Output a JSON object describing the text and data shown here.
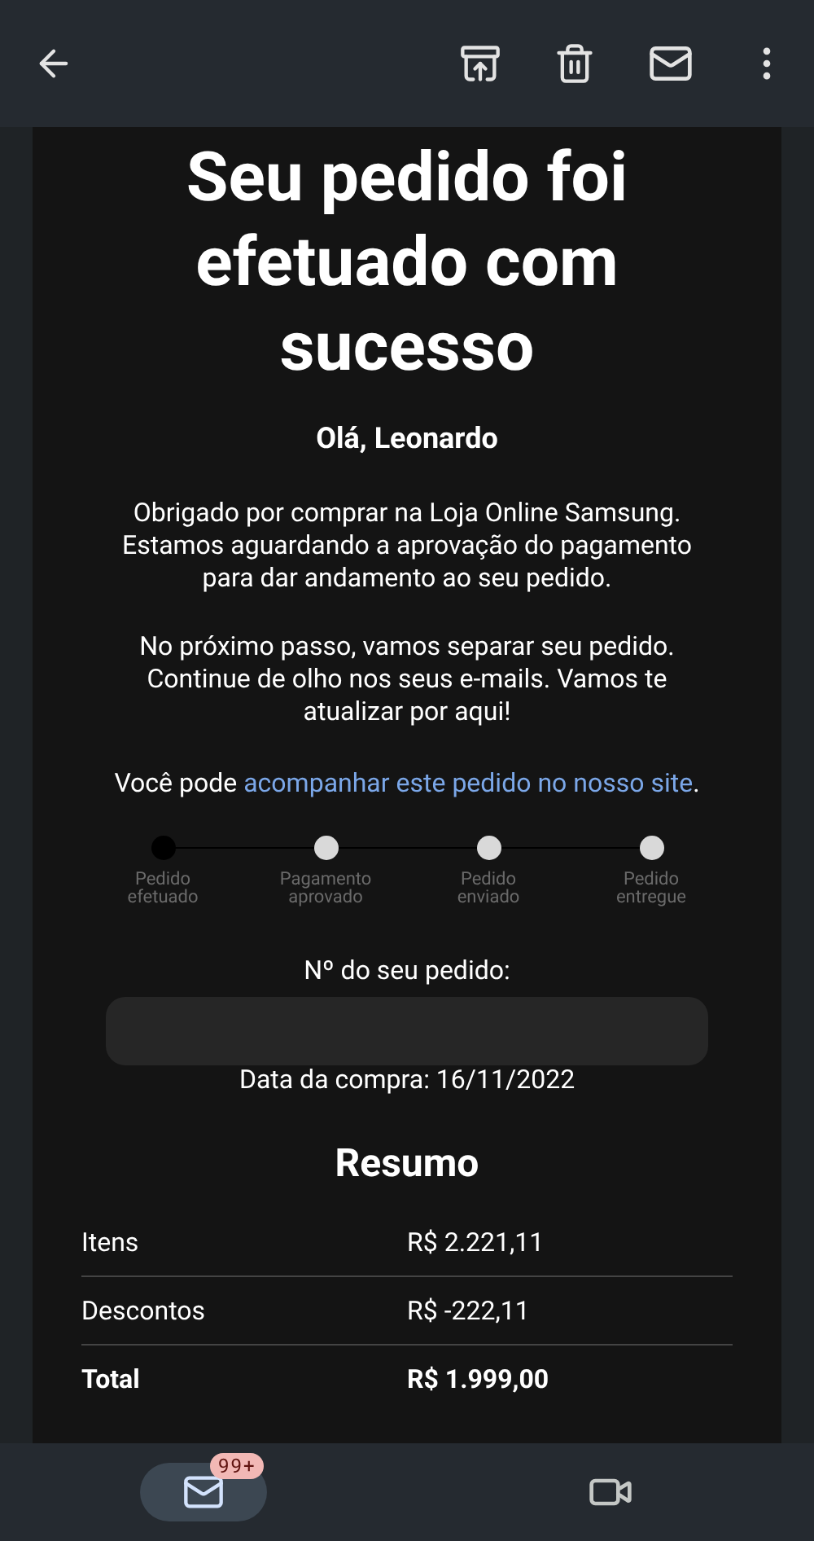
{
  "toolbar": {
    "actions": [
      {
        "kind": "archive"
      },
      {
        "kind": "delete"
      },
      {
        "kind": "mail"
      },
      {
        "kind": "more"
      }
    ]
  },
  "email": {
    "title": "Seu pedido foi efetuado com sucesso",
    "greeting": "Olá, Leonardo",
    "paragraphs": [
      "Obrigado por comprar na Loja Online Samsung. Estamos aguardando a aprovação do pagamento para dar andamento ao seu pedido.",
      "No próximo passo, vamos separar seu pedido. Continue de olho nos seus e-mails. Vamos te atualizar por aqui!"
    ],
    "track": {
      "before": "Você pode ",
      "link": "acompanhar este pedido no nosso site",
      "after": "."
    },
    "steps": [
      {
        "label": "Pedido efetuado",
        "selected": true
      },
      {
        "label": "Pagamento aprovado",
        "selected": false
      },
      {
        "label": "Pedido enviado",
        "selected": false
      },
      {
        "label": "Pedido entregue",
        "selected": false
      }
    ],
    "order_label": "Nº do seu pedido:",
    "purchase_date": "Data da compra: 16/11/2022",
    "summary_title": "Resumo",
    "summary": [
      {
        "label": "Itens",
        "value": "R$ 2.221,11",
        "bold": false
      },
      {
        "label": "Descontos",
        "value": "R$ -222,11",
        "bold": false
      },
      {
        "label": "Total",
        "value": "R$ 1.999,00",
        "bold": true
      }
    ]
  },
  "bottom_nav": [
    {
      "kind": "mail",
      "selected": true,
      "badge": "99+"
    },
    {
      "kind": "video",
      "selected": false
    }
  ]
}
